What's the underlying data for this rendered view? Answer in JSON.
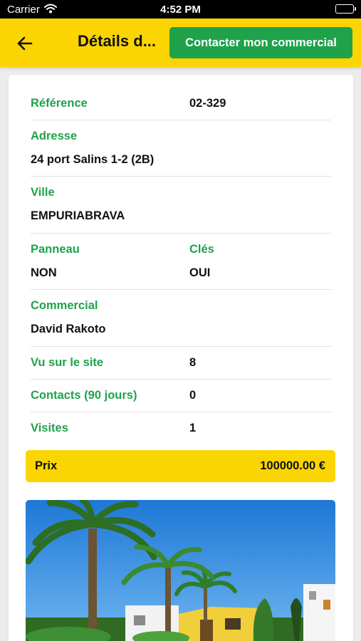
{
  "status_bar": {
    "carrier": "Carrier",
    "time": "4:52 PM"
  },
  "header": {
    "title": "Détails d...",
    "contact_button": "Contacter mon commercial",
    "accent_color": "#fad502",
    "button_color": "#1fa24a"
  },
  "details": {
    "reference": {
      "label": "Référence",
      "value": "02-329"
    },
    "address": {
      "label": "Adresse",
      "value": "24 port Salins 1-2 (2B)"
    },
    "city": {
      "label": "Ville",
      "value": "EMPURIABRAVA"
    },
    "sign": {
      "label": "Panneau",
      "value": "NON"
    },
    "keys": {
      "label": "Clés",
      "value": "OUI"
    },
    "salesperson": {
      "label": "Commercial",
      "value": "David Rakoto"
    },
    "site_views": {
      "label": "Vu sur le site",
      "value": "8"
    },
    "contacts": {
      "label": "Contacts (90 jours)",
      "value": "0"
    },
    "visits": {
      "label": "Visites",
      "value": "1"
    }
  },
  "price": {
    "label": "Prix",
    "value": "100000.00 €"
  },
  "icons": {
    "back": "arrow-left-icon",
    "wifi": "wifi-icon",
    "battery": "battery-icon"
  }
}
